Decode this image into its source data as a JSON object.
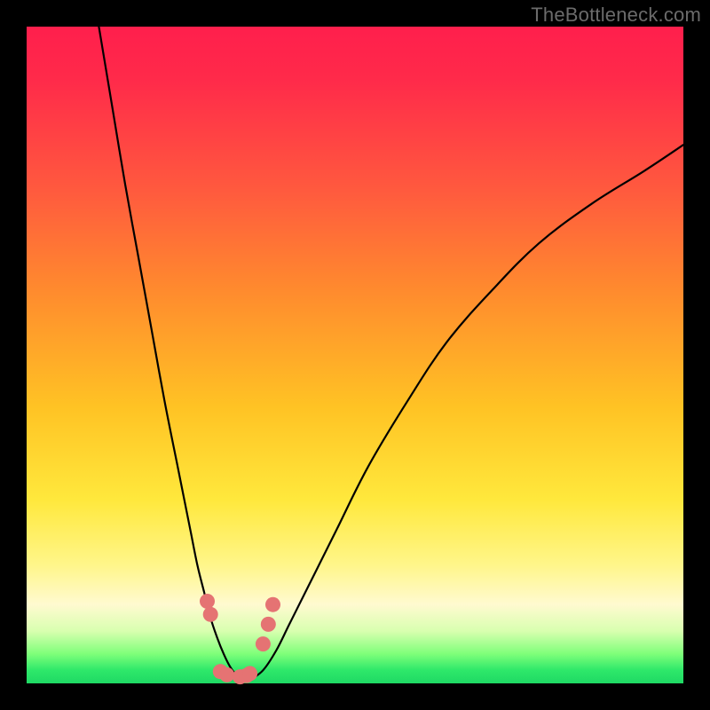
{
  "watermark": "TheBottleneck.com",
  "colors": {
    "background": "#000000",
    "gradient_top": "#ff1f4c",
    "gradient_mid1": "#ff8a2e",
    "gradient_mid2": "#ffe83c",
    "gradient_pale": "#fffad0",
    "gradient_green": "#1fd964",
    "curve_stroke": "#000000",
    "marker_fill": "#e57373",
    "watermark_text": "#6b6b6b"
  },
  "chart_data": {
    "type": "line",
    "title": "",
    "xlabel": "",
    "ylabel": "",
    "xlim": [
      0,
      100
    ],
    "ylim": [
      0,
      100
    ],
    "grid": false,
    "legend": false,
    "note": "axes unlabeled; values are approximate normalized 0–100 read from plot geometry",
    "series": [
      {
        "name": "left-curve",
        "x": [
          11,
          13,
          15,
          17,
          19,
          21,
          23,
          24,
          25,
          26,
          27,
          28,
          29,
          30,
          31,
          32,
          33
        ],
        "y": [
          100,
          88,
          76,
          65,
          54,
          43,
          33,
          28,
          23,
          18,
          14,
          10,
          7,
          4.5,
          2.5,
          1.2,
          0.5
        ]
      },
      {
        "name": "right-curve",
        "x": [
          34,
          36,
          38,
          40,
          43,
          47,
          52,
          58,
          64,
          71,
          78,
          86,
          94,
          100
        ],
        "y": [
          0.5,
          2,
          5,
          9,
          15,
          23,
          33,
          43,
          52,
          60,
          67,
          73,
          78,
          82
        ]
      },
      {
        "name": "valley-markers",
        "type": "scatter",
        "x": [
          27.5,
          28.0,
          29.5,
          30.5,
          32.5,
          33.5,
          34.0,
          36.0,
          36.8,
          37.5
        ],
        "y": [
          12.5,
          10.5,
          1.8,
          1.3,
          1.0,
          1.2,
          1.5,
          6.0,
          9.0,
          12.0
        ]
      }
    ]
  }
}
